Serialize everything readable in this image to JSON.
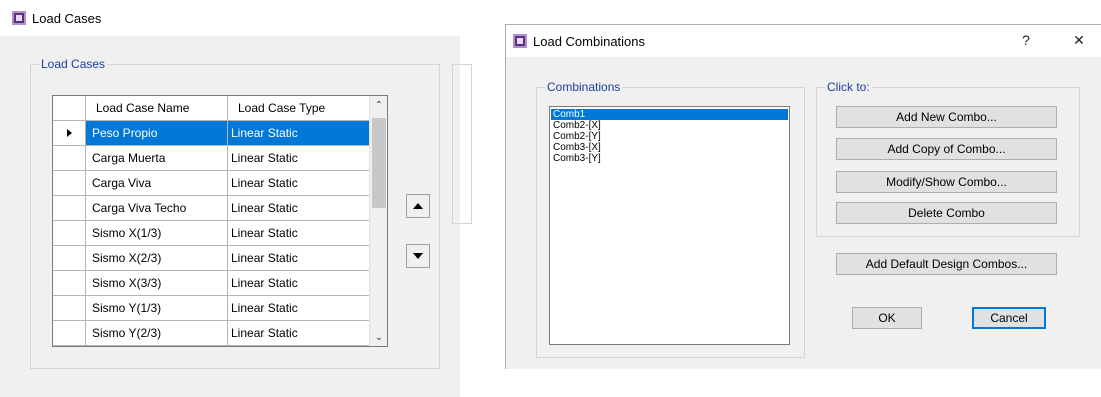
{
  "load_cases_window": {
    "title": "Load Cases",
    "group_label": "Load Cases",
    "table": {
      "columns": [
        "Load Case Name",
        "Load Case Type"
      ],
      "rows": [
        {
          "name": "Peso Propio",
          "type": "Linear Static"
        },
        {
          "name": "Carga Muerta",
          "type": "Linear Static"
        },
        {
          "name": "Carga Viva",
          "type": "Linear Static"
        },
        {
          "name": "Carga Viva Techo",
          "type": "Linear Static"
        },
        {
          "name": "Sismo X(1/3)",
          "type": "Linear Static"
        },
        {
          "name": "Sismo X(2/3)",
          "type": "Linear Static"
        },
        {
          "name": "Sismo X(3/3)",
          "type": "Linear Static"
        },
        {
          "name": "Sismo Y(1/3)",
          "type": "Linear Static"
        },
        {
          "name": "Sismo Y(2/3)",
          "type": "Linear Static"
        }
      ],
      "selected_row": 0
    },
    "icons": {
      "move_up": "move-up-icon",
      "move_down": "move-down-icon"
    }
  },
  "load_combinations_window": {
    "title": "Load Combinations",
    "help_label": "?",
    "close_label": "✕",
    "combinations_label": "Combinations",
    "combinations": [
      "Comb1",
      "Comb2-[X]",
      "Comb2-[Y]",
      "Comb3-[X]",
      "Comb3-[Y]"
    ],
    "selected_combination": 0,
    "click_to_label": "Click to:",
    "buttons": {
      "add_new": "Add New Combo...",
      "add_copy": "Add Copy of Combo...",
      "modify_show": "Modify/Show Combo...",
      "delete": "Delete Combo",
      "add_default": "Add Default Design Combos...",
      "ok": "OK",
      "cancel": "Cancel"
    }
  },
  "colors": {
    "selection": "#0078d7",
    "group_label": "#1a3f9c",
    "window_bg": "#f0f0f0"
  }
}
